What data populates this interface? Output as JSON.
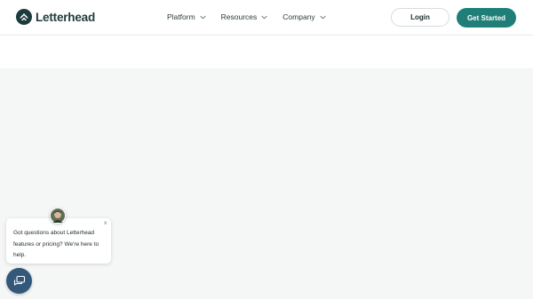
{
  "brand": {
    "name": "Letterhead",
    "color": "#1f7e78",
    "dark": "#1d3b3d"
  },
  "nav": {
    "items": [
      {
        "label": "Platform",
        "icon": "chevron-down-icon"
      },
      {
        "label": "Resources",
        "icon": "chevron-down-icon"
      },
      {
        "label": "Company",
        "icon": "chevron-down-icon"
      }
    ],
    "login_label": "Login",
    "cta_label": "Get Started"
  },
  "chat": {
    "message": "Got questions about Letterhead features or pricing? We're here to help.",
    "close": "×",
    "launcher_icon": "chat-bubbles-icon",
    "launcher_color": "#34587a"
  }
}
